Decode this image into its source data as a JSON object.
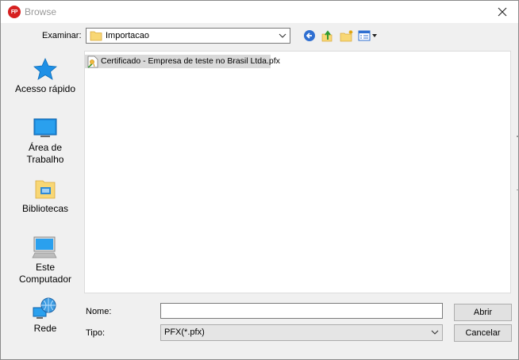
{
  "window": {
    "title": "Browse",
    "logo_text": "FP"
  },
  "lookin": {
    "label": "Examinar:",
    "value": "Importacao"
  },
  "toolbar": {
    "back_icon": "back-arrow-icon",
    "up_icon": "up-folder-icon",
    "new_folder_icon": "new-folder-icon",
    "view_icon": "view-menu-icon"
  },
  "places": [
    {
      "label": "Acesso rápido",
      "icon": "star-icon"
    },
    {
      "label": "Área de Trabalho",
      "icon": "desktop-icon"
    },
    {
      "label": "Bibliotecas",
      "icon": "library-icon"
    },
    {
      "label": "Este Computador",
      "icon": "computer-icon"
    },
    {
      "label": "Rede",
      "icon": "network-icon"
    }
  ],
  "files": [
    {
      "name": "Certificado - Empresa de teste no Brasil Ltda.pfx",
      "icon": "certificate-file-icon"
    }
  ],
  "filename": {
    "label": "Nome:",
    "value": ""
  },
  "filetype": {
    "label": "Tipo:",
    "value": "PFX(*.pfx)"
  },
  "buttons": {
    "open": "Abrir",
    "cancel": "Cancelar"
  },
  "colors": {
    "accent": "#0078d7",
    "selection": "#d9d9d9",
    "logo": "#d62020"
  }
}
